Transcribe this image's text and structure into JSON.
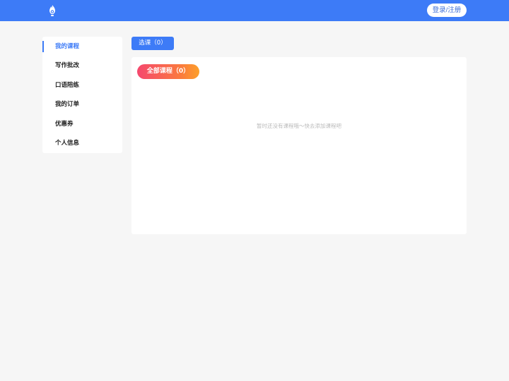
{
  "header": {
    "logo_icon": "flame-logo-icon",
    "login_label": "登录/注册",
    "bg_color": "#3d7bf7"
  },
  "sidebar": {
    "items": [
      {
        "label": "我的课程",
        "active": true
      },
      {
        "label": "写作批改",
        "active": false
      },
      {
        "label": "口语陪练",
        "active": false
      },
      {
        "label": "我的订单",
        "active": false
      },
      {
        "label": "优惠券",
        "active": false
      },
      {
        "label": "个人信息",
        "active": false
      }
    ]
  },
  "main": {
    "select_course_label": "选课（0）",
    "all_courses_label": "全部课程（0）",
    "empty_message": "暂时还没有课程哦～快去添加课程吧"
  }
}
